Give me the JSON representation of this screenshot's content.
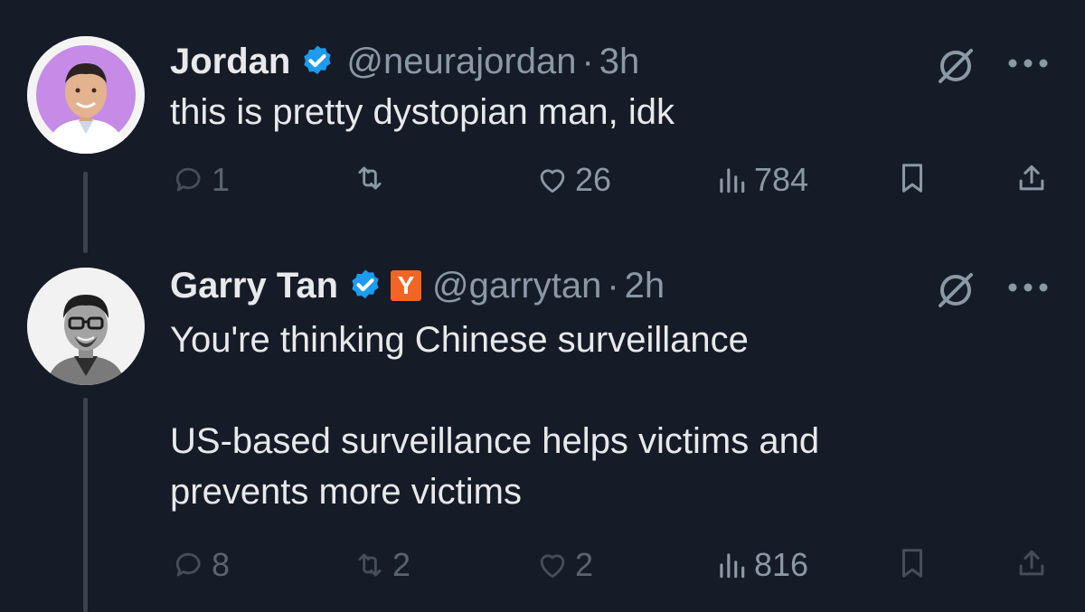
{
  "tweets": [
    {
      "name": "Jordan",
      "handle": "@neurajordan",
      "separator": "·",
      "time": "3h",
      "verified": true,
      "badge": "",
      "text_lines": [
        "this is pretty dystopian man, idk"
      ],
      "stats": {
        "replies": "1",
        "retweets": "",
        "likes": "26",
        "views": "784"
      }
    },
    {
      "name": "Garry Tan",
      "handle": "@garrytan",
      "separator": "·",
      "time": "2h",
      "verified": true,
      "badge": "Y",
      "text_lines": [
        "You're thinking Chinese surveillance",
        "",
        "US-based surveillance helps victims and",
        "prevents more victims"
      ],
      "stats": {
        "replies": "8",
        "retweets": "2",
        "likes": "2",
        "views": "816"
      }
    }
  ],
  "colors": {
    "background": "#151b27",
    "verified": "#1d9bf0",
    "ycombinator": "#f26522",
    "muted": "#8b98a5"
  },
  "icons": [
    "verified-icon",
    "grok-icon",
    "more-icon",
    "reply-icon",
    "retweet-icon",
    "like-icon",
    "views-icon",
    "bookmark-icon",
    "share-icon"
  ]
}
